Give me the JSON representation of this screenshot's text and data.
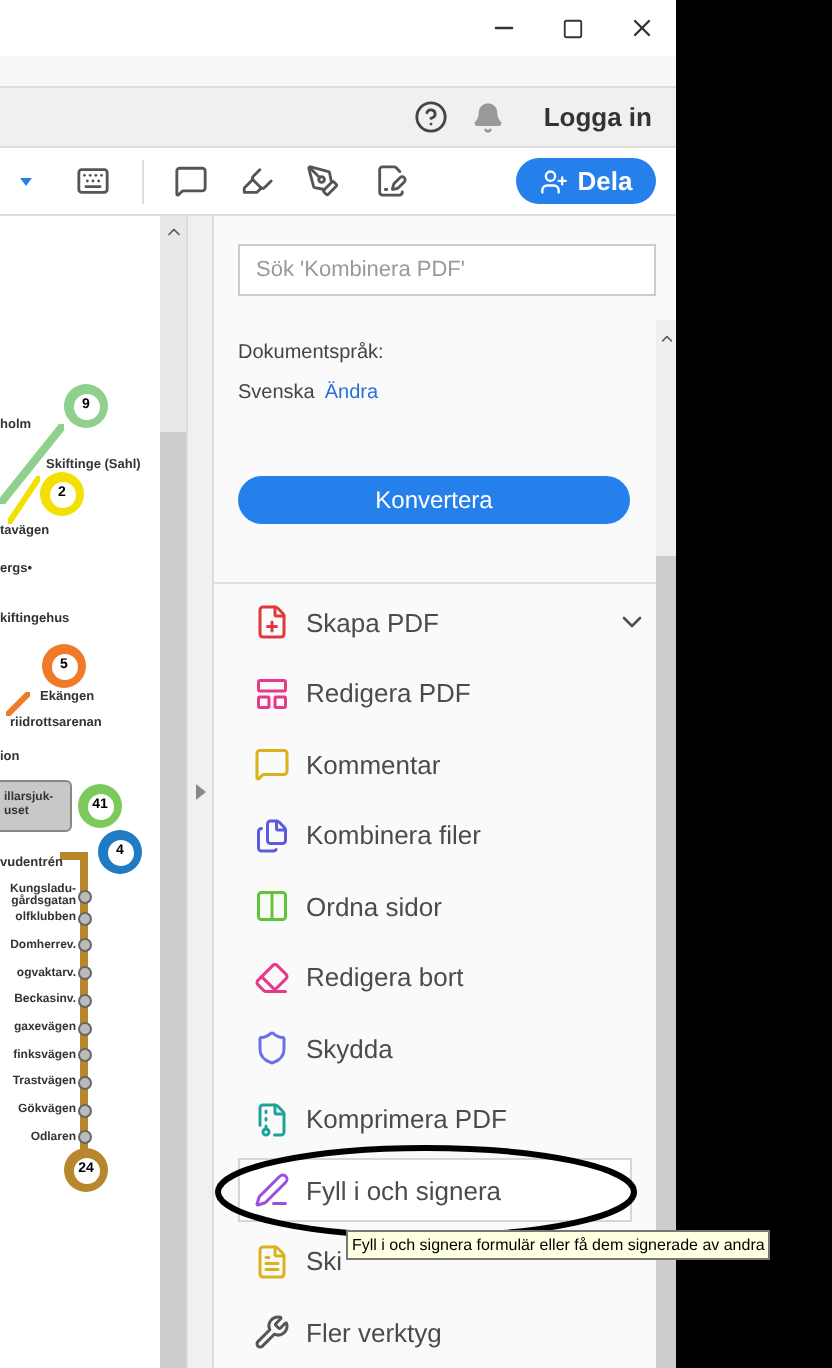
{
  "header": {
    "login": "Logga in"
  },
  "toolbar": {
    "share_button": "Dela"
  },
  "map": {
    "routes": [
      {
        "number": "9",
        "color": "#8fd08f"
      },
      {
        "number": "2",
        "color": "#f2e000"
      },
      {
        "number": "5",
        "color": "#f07a28"
      },
      {
        "number": "41",
        "color": "#7cc95c"
      },
      {
        "number": "4",
        "color": "#1f7bc4"
      },
      {
        "number": "24",
        "color": "#b8862c"
      }
    ],
    "labels": [
      "holm",
      "Skiftinge (Sahl)",
      "tavägen",
      "ergs•",
      "kiftingehus",
      "Ekängen",
      "riidrottsarenan",
      "ion",
      "vudentrén"
    ],
    "box_lines": [
      "illarsjuk-",
      "uset"
    ],
    "stations": [
      "Kungsladu-gårdsgatan",
      "olfklubben",
      "Domherrev.",
      "ogvaktarv.",
      "Beckasinv.",
      "gaxevägen",
      "finksvägen",
      "Trastvägen",
      "Gökvägen",
      "Odlaren"
    ]
  },
  "panel": {
    "search": {
      "placeholder": "Sök 'Kombinera PDF'"
    },
    "language_label": "Dokumentspråk:",
    "language": "Svenska",
    "change_link": "Ändra",
    "convert_button": "Konvertera",
    "tools": [
      {
        "label": "Skapa PDF",
        "kind": "create",
        "menu": true,
        "hovered": false
      },
      {
        "label": "Redigera PDF",
        "kind": "edit",
        "menu": false,
        "hovered": false
      },
      {
        "label": "Kommentar",
        "kind": "comment",
        "menu": false,
        "hovered": false
      },
      {
        "label": "Kombinera filer",
        "kind": "combine",
        "menu": false,
        "hovered": false
      },
      {
        "label": "Ordna sidor",
        "kind": "organize",
        "menu": false,
        "hovered": false
      },
      {
        "label": "Redigera bort",
        "kind": "redact",
        "menu": false,
        "hovered": false
      },
      {
        "label": "Skydda",
        "kind": "protect",
        "menu": false,
        "hovered": false
      },
      {
        "label": "Komprimera PDF",
        "kind": "compress",
        "menu": false,
        "hovered": false
      },
      {
        "label": "Fyll i och signera",
        "kind": "sign",
        "menu": false,
        "hovered": true
      },
      {
        "label": "Ski",
        "kind": "review",
        "menu": false,
        "hovered": false
      },
      {
        "label": "Fler verktyg",
        "kind": "more",
        "menu": false,
        "hovered": false
      }
    ],
    "tooltip": "Fyll i och signera formulär eller få dem signerade av andra"
  }
}
